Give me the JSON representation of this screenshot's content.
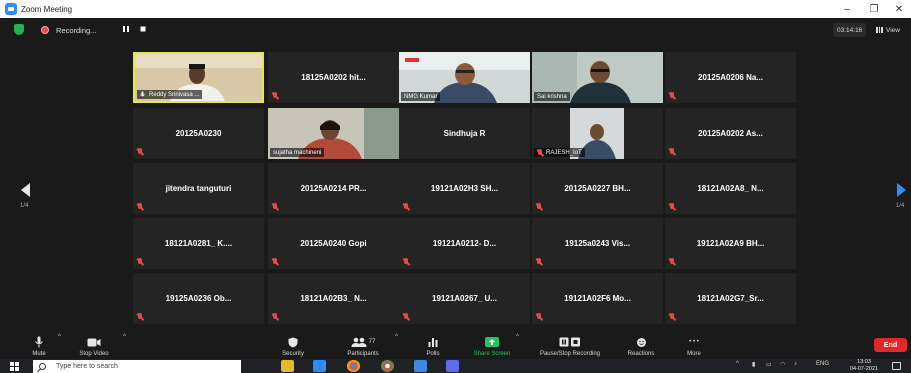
{
  "window": {
    "title": "Zoom Meeting",
    "minimize": "–",
    "maximize": "❐",
    "close": "✕"
  },
  "topbar": {
    "recording_label": "Recording...",
    "pause_icon": "pause-icon",
    "stop_icon": "stop-icon",
    "elapsed_time": "03:14:16",
    "view_label": "View"
  },
  "gallery": {
    "page_left": "1/4",
    "page_right": "1/4",
    "video_tiles": [
      {
        "name": "Reddy Srinivasa ...",
        "active": true,
        "mic": "unmuted"
      },
      {
        "name": "NMG Kumar",
        "mic": "unmuted"
      },
      {
        "name": "Sai krishna",
        "mic": "unmuted"
      },
      {
        "name": "sujatha machineni",
        "mic": "unmuted"
      },
      {
        "name": "RAJESH_IoT",
        "mic": "muted"
      }
    ],
    "name_tiles": [
      "18125A0202 hit...",
      "20125A0206 Na...",
      "20125A0230",
      "Sindhuja R",
      "20125A0202 As...",
      "jitendra tanguturi",
      "20125A0214 PR...",
      "19121A02H3 SH...",
      "20125A0227 BH...",
      "18121A02A8_ N...",
      "18121A0281_ K....",
      "20125A0240 Gopi",
      "19121A0212- D...",
      "19125a0243 Vis...",
      "19121A02A9 BH...",
      "19125A0236 Ob...",
      "18121A02B3_ N...",
      "19121A0267_ U...",
      "19121A02F6 Mo...",
      "18121A02G7_Sr..."
    ]
  },
  "toolbar": {
    "mute": "Mute",
    "stop_video": "Stop Video",
    "security": "Security",
    "participants": "Participants",
    "participants_count": "77",
    "polls": "Polls",
    "share_screen": "Share Screen",
    "pause_stop_recording": "Pause/Stop Recording",
    "reactions": "Reactions",
    "more": "More",
    "more_dots": "• • •",
    "end": "End"
  },
  "taskbar": {
    "search_placeholder": "Type here to search",
    "language": "ENG",
    "time": "13:03",
    "date": "04-07-2021"
  },
  "colors": {
    "background": "#1a1a1a",
    "tile": "#242424",
    "active_speaker": "#e1e84a",
    "muted": "#e5484d",
    "share": "#22c55e",
    "end": "#e02828",
    "accent": "#2d8cff"
  }
}
